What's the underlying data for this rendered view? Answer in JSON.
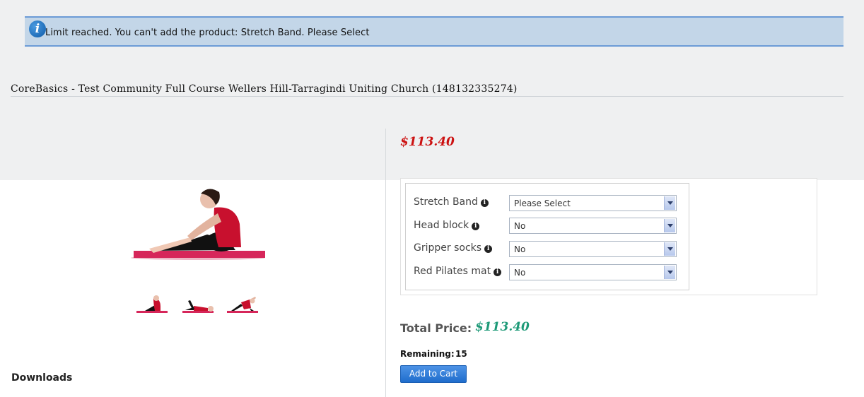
{
  "alert": {
    "icon": "info-icon",
    "message": "Limit reached. You can't add the product: Stretch Band. Please Select"
  },
  "product": {
    "title": "CoreBasics - Test Community Full Course Wellers Hill-Tarragindi Uniting Church (148132335274)",
    "price": "$113.40"
  },
  "images": {
    "main": "woman-seated-stretch-on-mat",
    "thumbnails": [
      "seated-stretch-thumbnail",
      "lying-stretch-thumbnail",
      "side-lunge-thumbnail"
    ]
  },
  "options": [
    {
      "label": "Stretch Band",
      "value": "Please Select"
    },
    {
      "label": "Head block",
      "value": "No"
    },
    {
      "label": "Gripper socks",
      "value": "No"
    },
    {
      "label": "Red Pilates mat",
      "value": "No"
    }
  ],
  "totals": {
    "total_label": "Total Price:",
    "total_value": "$113.40",
    "remaining_label": "Remaining:",
    "remaining_value": "15"
  },
  "buttons": {
    "add_to_cart": "Add to Cart"
  },
  "sections": {
    "downloads": "Downloads"
  },
  "colors": {
    "price_red": "#cc1111",
    "total_green": "#1e9a78",
    "alert_bg": "#c3d6e8",
    "button_blue": "#1f6dcc"
  }
}
